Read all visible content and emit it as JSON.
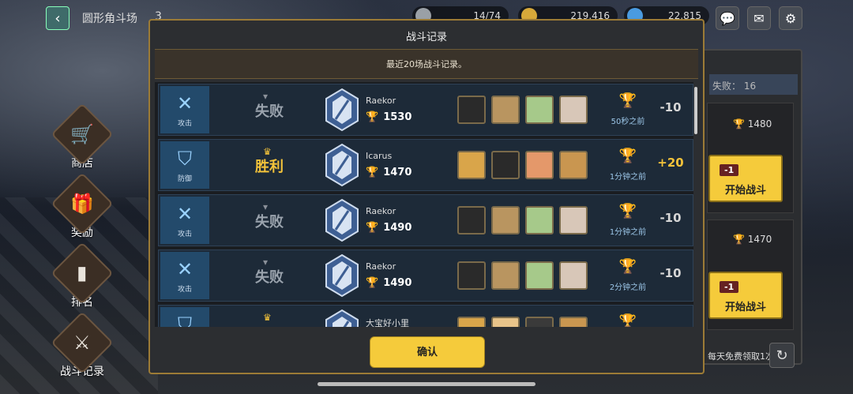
{
  "topbar": {
    "back_icon": "back-arrow-icon",
    "title": "圆形角斗场",
    "page_num": "3",
    "resources": [
      {
        "name": "stamina",
        "value": "14/74",
        "color": "#9aa0a6"
      },
      {
        "name": "gold",
        "value": "219,416",
        "color": "#d7a93a"
      },
      {
        "name": "gems",
        "value": "22,815",
        "color": "#4a9be0"
      }
    ],
    "icons": [
      "chat-icon",
      "mail-icon",
      "gear-icon"
    ]
  },
  "side_menu": [
    {
      "label": "商店",
      "icon": "cart-icon"
    },
    {
      "label": "奖励",
      "icon": "gift-icon"
    },
    {
      "label": "排名",
      "icon": "podium-icon"
    },
    {
      "label": "战斗记录",
      "icon": "battle-record-icon"
    }
  ],
  "right_panel": {
    "lose_label": "失败： 16",
    "cards": [
      {
        "score": "1480",
        "cost": "-1",
        "button": "开始战斗"
      },
      {
        "score": "1470",
        "cost": "-1",
        "button": "开始战斗"
      }
    ],
    "free_text": "每天免费领取1次"
  },
  "modal": {
    "title": "战斗记录",
    "subtitle": "最近20场战斗记录。",
    "confirm": "确认",
    "rows": [
      {
        "tag": "攻击",
        "tag_icon": "swords-icon",
        "result": "失败",
        "result_type": "lose",
        "name": "Raekor",
        "score": "1530",
        "heroes": [
          "#2a2a2a",
          "#b99560",
          "#a6c98a",
          "#d8c7b8"
        ],
        "when": "50秒之前",
        "delta": "-10",
        "delta_type": "neg"
      },
      {
        "tag": "防御",
        "tag_icon": "shield-icon",
        "result": "胜利",
        "result_type": "win",
        "name": "Icarus",
        "score": "1470",
        "heroes": [
          "#d9a54a",
          "#2a2a2a",
          "#e4986a",
          "#c99650"
        ],
        "when": "1分钟之前",
        "delta": "+20",
        "delta_type": "pos"
      },
      {
        "tag": "攻击",
        "tag_icon": "swords-icon",
        "result": "失败",
        "result_type": "lose",
        "name": "Raekor",
        "score": "1490",
        "heroes": [
          "#2a2a2a",
          "#b99560",
          "#a6c98a",
          "#d8c7b8"
        ],
        "when": "1分钟之前",
        "delta": "-10",
        "delta_type": "neg"
      },
      {
        "tag": "攻击",
        "tag_icon": "swords-icon",
        "result": "失败",
        "result_type": "lose",
        "name": "Raekor",
        "score": "1490",
        "heroes": [
          "#2a2a2a",
          "#b99560",
          "#a6c98a",
          "#d8c7b8"
        ],
        "when": "2分钟之前",
        "delta": "-10",
        "delta_type": "neg"
      },
      {
        "tag": "",
        "tag_icon": "shield-icon",
        "result": "",
        "result_type": "win",
        "name": "大宝好小里",
        "score": "",
        "heroes": [
          "#d9a54a",
          "#e8c48a",
          "#3a3a3a",
          "#c99650"
        ],
        "when": "",
        "delta": "",
        "delta_type": "pos"
      }
    ]
  }
}
